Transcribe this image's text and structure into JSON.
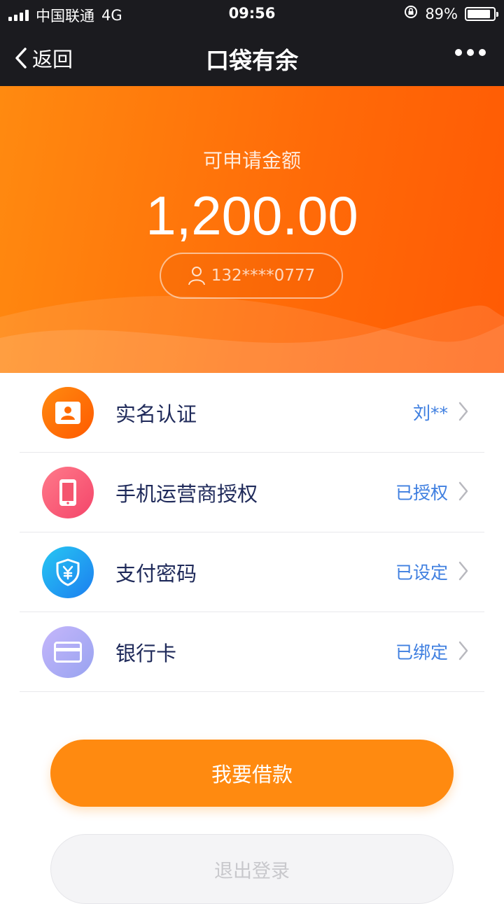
{
  "status_bar": {
    "carrier": "中国联通",
    "network": "4G",
    "time": "09:56",
    "battery": "89%",
    "battery_level": 0.89
  },
  "nav": {
    "back_label": "返回",
    "title": "口袋有余"
  },
  "hero": {
    "label": "可申请金额",
    "amount": "1,200.00",
    "phone": "132****0777"
  },
  "items": [
    {
      "name": "实名认证",
      "status": "刘**",
      "icon": "id-card-icon",
      "color": "#ff6a00"
    },
    {
      "name": "手机运营商授权",
      "status": "已授权",
      "icon": "phone-icon",
      "color": "#ff5a7a"
    },
    {
      "name": "支付密码",
      "status": "已设定",
      "icon": "shield-yuan-icon",
      "color": "#1e9cf5"
    },
    {
      "name": "银行卡",
      "status": "已绑定",
      "icon": "bank-card-icon",
      "color": "#a99cf5"
    }
  ],
  "buttons": {
    "borrow": "我要借款",
    "logout": "退出登录"
  },
  "colors": {
    "accent": "#ff8a10",
    "nav_bg": "#1b1b1f",
    "status_link": "#3f7fe0",
    "item_text": "#1f2a5a"
  }
}
